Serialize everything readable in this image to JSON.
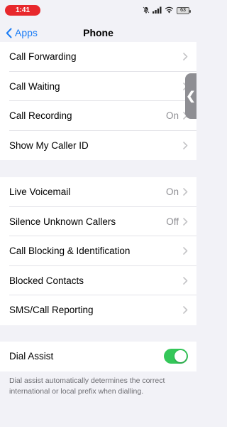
{
  "status_bar": {
    "time": "1:41",
    "battery": "63",
    "icons": [
      "bell-slash-icon",
      "signal-icon",
      "wifi-icon",
      "battery-icon"
    ]
  },
  "nav": {
    "back_label": "Apps",
    "title": "Phone"
  },
  "group1": {
    "rows": [
      {
        "label": "Call Forwarding",
        "value": ""
      },
      {
        "label": "Call Waiting",
        "value": ""
      },
      {
        "label": "Call Recording",
        "value": "On"
      },
      {
        "label": "Show My Caller ID",
        "value": ""
      }
    ]
  },
  "group2": {
    "rows": [
      {
        "label": "Live Voicemail",
        "value": "On"
      },
      {
        "label": "Silence Unknown Callers",
        "value": "Off"
      },
      {
        "label": "Call Blocking & Identification",
        "value": ""
      },
      {
        "label": "Blocked Contacts",
        "value": ""
      },
      {
        "label": "SMS/Call Reporting",
        "value": ""
      }
    ]
  },
  "group3": {
    "label": "Dial Assist",
    "toggle_on": true,
    "footer": "Dial assist automatically determines the correct international or local prefix when dialling."
  },
  "side_handle": {
    "glyph": "❮"
  },
  "colors": {
    "accent": "#1a7cf5",
    "toggle_on": "#34c759",
    "time_pill": "#e8282c",
    "background": "#f2f2f7"
  }
}
